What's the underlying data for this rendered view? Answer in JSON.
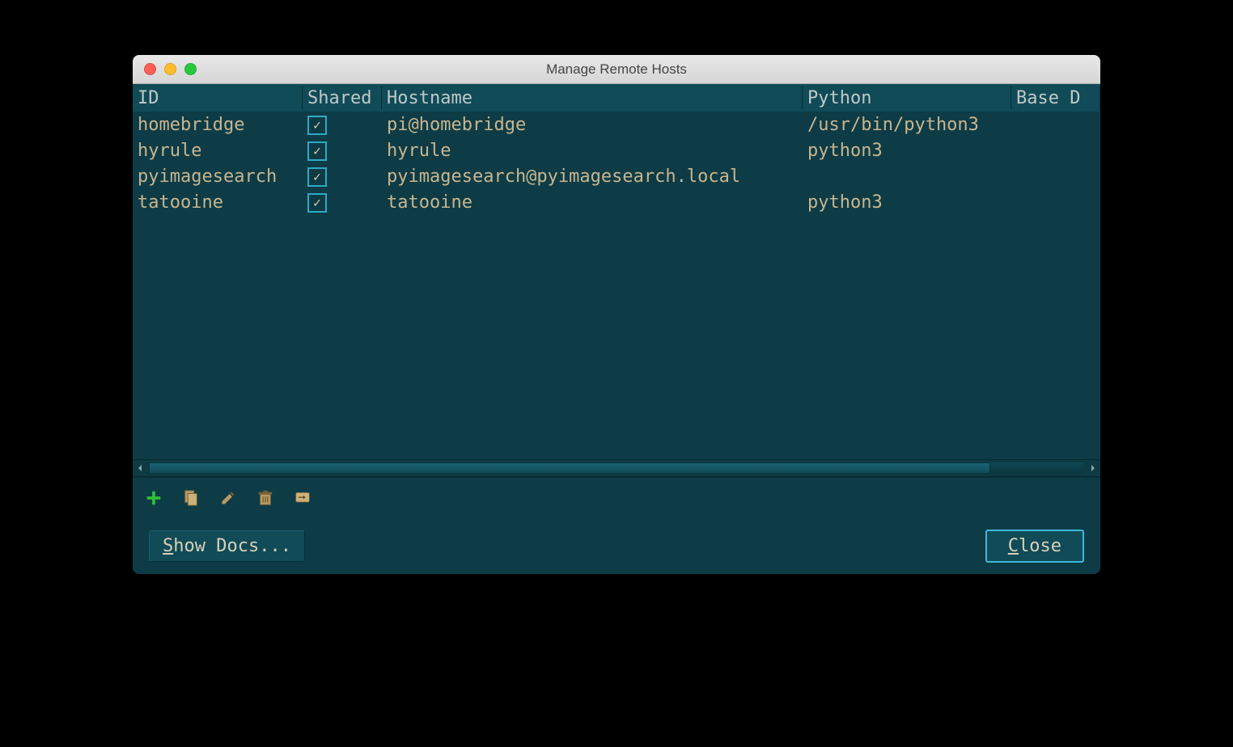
{
  "window": {
    "title": "Manage Remote Hosts"
  },
  "columns": {
    "id": "ID",
    "shared": "Shared",
    "hostname": "Hostname",
    "python": "Python",
    "based": "Base D"
  },
  "rows": [
    {
      "id": "homebridge",
      "shared": true,
      "hostname": "pi@homebridge",
      "python": "/usr/bin/python3"
    },
    {
      "id": "hyrule",
      "shared": true,
      "hostname": "hyrule",
      "python": "python3"
    },
    {
      "id": "pyimagesearch",
      "shared": true,
      "hostname": "pyimagesearch@pyimagesearch.local",
      "python": ""
    },
    {
      "id": "tatooine",
      "shared": true,
      "hostname": "tatooine",
      "python": "python3"
    }
  ],
  "toolbar_icons": {
    "add": "add-icon",
    "copy": "copy-icon",
    "edit": "edit-icon",
    "delete": "delete-icon",
    "connect": "connect-icon"
  },
  "buttons": {
    "show_docs_prefix": "S",
    "show_docs_rest": "how Docs...",
    "close_prefix": "C",
    "close_rest": "lose"
  }
}
